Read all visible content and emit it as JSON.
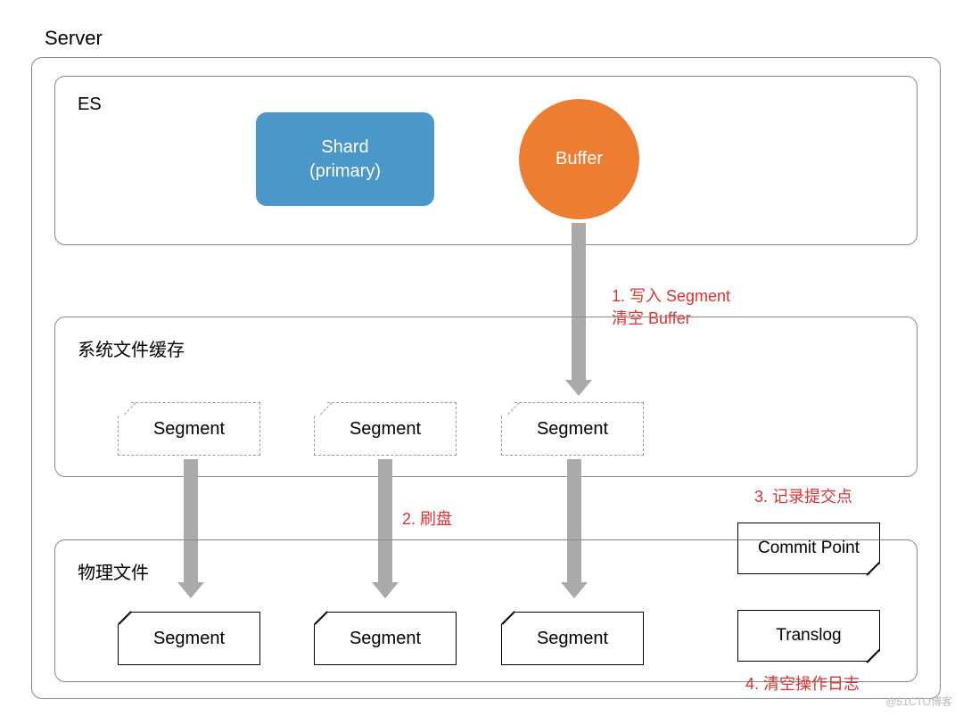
{
  "title": "Server",
  "es": {
    "label": "ES",
    "shard_line1": "Shard",
    "shard_line2": "(primary)",
    "buffer": "Buffer"
  },
  "cache": {
    "label": "系统文件缓存",
    "segments": [
      "Segment",
      "Segment",
      "Segment"
    ]
  },
  "phys": {
    "label": "物理文件",
    "segments": [
      "Segment",
      "Segment",
      "Segment"
    ],
    "commit": "Commit Point",
    "translog": "Translog"
  },
  "notes": {
    "n1": "1. 写入 Segment\n清空 Buffer",
    "n2": "2. 刷盘",
    "n3": "3. 记录提交点",
    "n4": "4. 清空操作日志"
  },
  "watermark": "@51CTO博客"
}
